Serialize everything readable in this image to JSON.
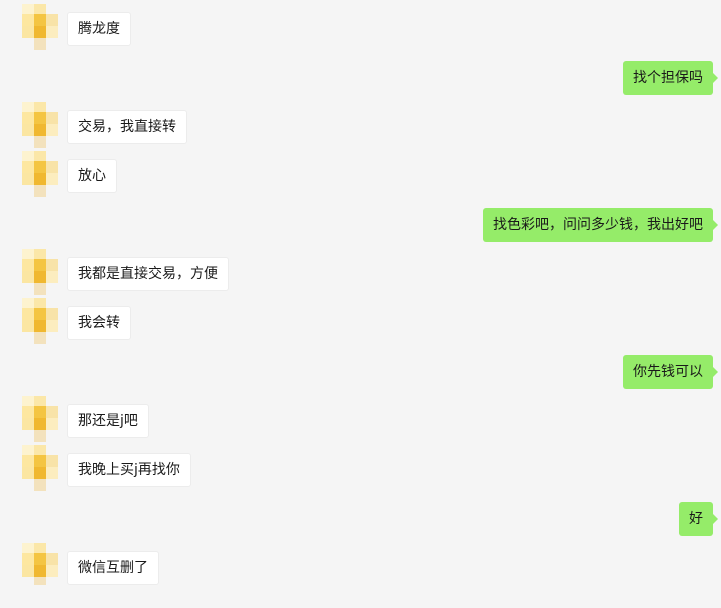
{
  "colors": {
    "background": "#f5f5f5",
    "incoming_bubble": "#ffffff",
    "outgoing_bubble": "#95ec69",
    "text": "#1a1a1a"
  },
  "messages": [
    {
      "side": "in",
      "text": "腾龙度"
    },
    {
      "side": "out",
      "text": "找个担保吗"
    },
    {
      "side": "in",
      "text": "交易，我直接转"
    },
    {
      "side": "in",
      "text": "放心"
    },
    {
      "side": "out",
      "text": "找色彩吧，问问多少钱，我出好吧"
    },
    {
      "side": "in",
      "text": "我都是直接交易，方便"
    },
    {
      "side": "in",
      "text": "我会转"
    },
    {
      "side": "out",
      "text": "你先钱可以"
    },
    {
      "side": "in",
      "text": "那还是j吧"
    },
    {
      "side": "in",
      "text": "我晚上买j再找你"
    },
    {
      "side": "out",
      "text": "好"
    },
    {
      "side": "in",
      "text": "微信互删了"
    }
  ]
}
